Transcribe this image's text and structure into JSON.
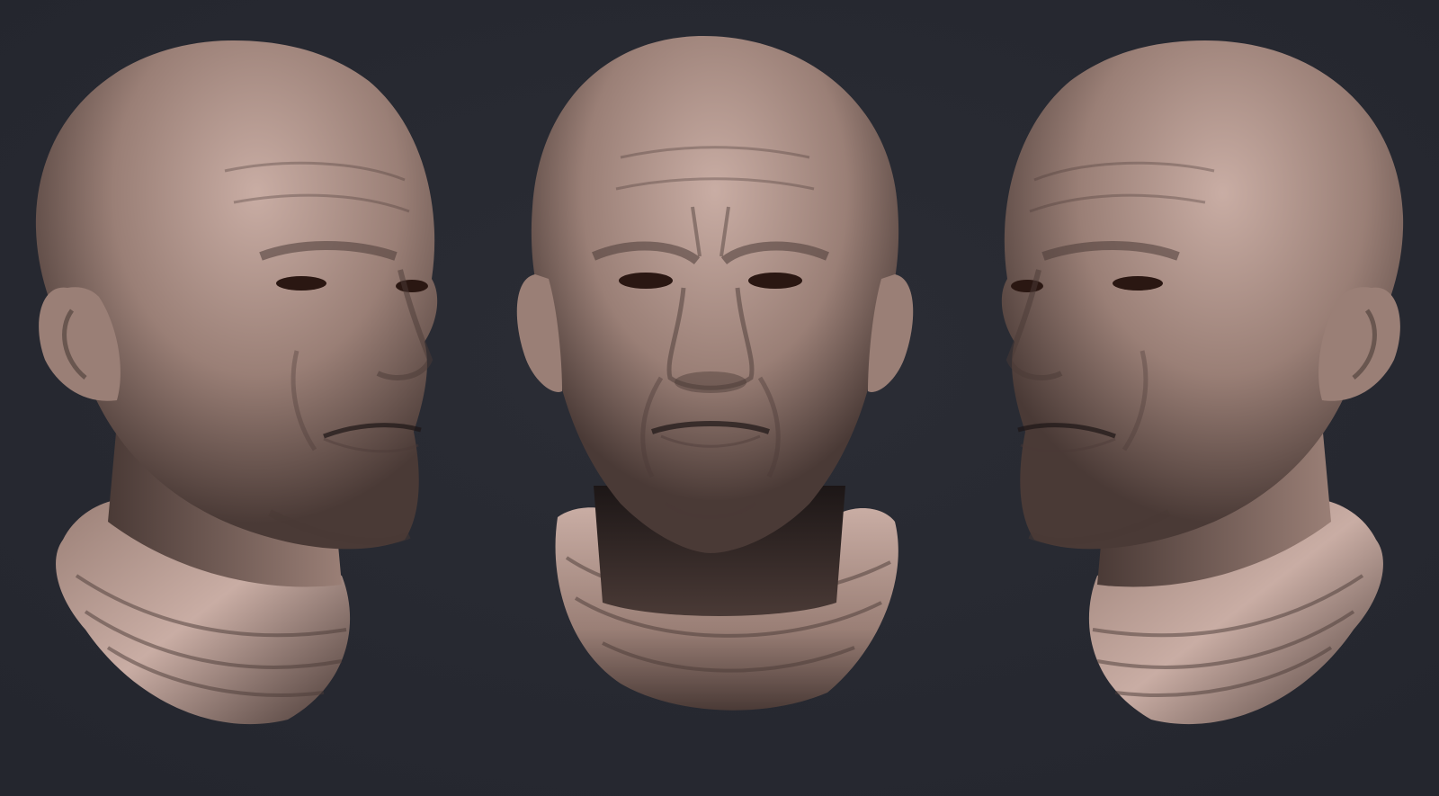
{
  "scene": {
    "background_color": "#24262e",
    "background_center_color": "#2b2d35",
    "clay_light": "#c9ada4",
    "clay_mid": "#9a7f76",
    "clay_dark": "#4a3a36",
    "clay_shadow": "#1c1616",
    "eye_color": "#2a1712",
    "busts": [
      {
        "view": "three-quarter-right",
        "subject": "bald-male-head-clay-sculpt"
      },
      {
        "view": "front",
        "subject": "bald-male-head-clay-sculpt"
      },
      {
        "view": "three-quarter-left",
        "subject": "bald-male-head-clay-sculpt"
      }
    ]
  }
}
